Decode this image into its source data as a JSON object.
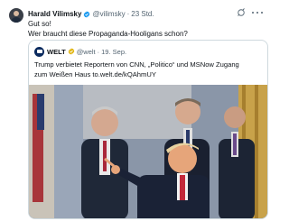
{
  "author": {
    "name": "Harald Vilimsky",
    "handle": "@vilimsky",
    "separator": "·",
    "time": "23 Std.",
    "verified_color": "#1d9bf0"
  },
  "tweet_text": {
    "line1": "Gut so!",
    "line2": "Wer braucht diese Propaganda-Hooligans schon?"
  },
  "quoted": {
    "logo_label": "WELT",
    "name": "WELT",
    "handle": "@welt",
    "separator": "·",
    "time": "19. Sep.",
    "verified_color": "#e2b719",
    "text_line1": "Trump verbietet Reportern von CNN, „Politico“ und MSNow Zugang",
    "text_line2": "zum Weißen Haus to.welt.de/kQAhmUY",
    "media_alt": "Foto: Trump mit Männern in Anzügen im Oval Office"
  },
  "icons": {
    "grok": "grok-icon",
    "more": "more-icon",
    "verified": "verified-badge-icon"
  }
}
